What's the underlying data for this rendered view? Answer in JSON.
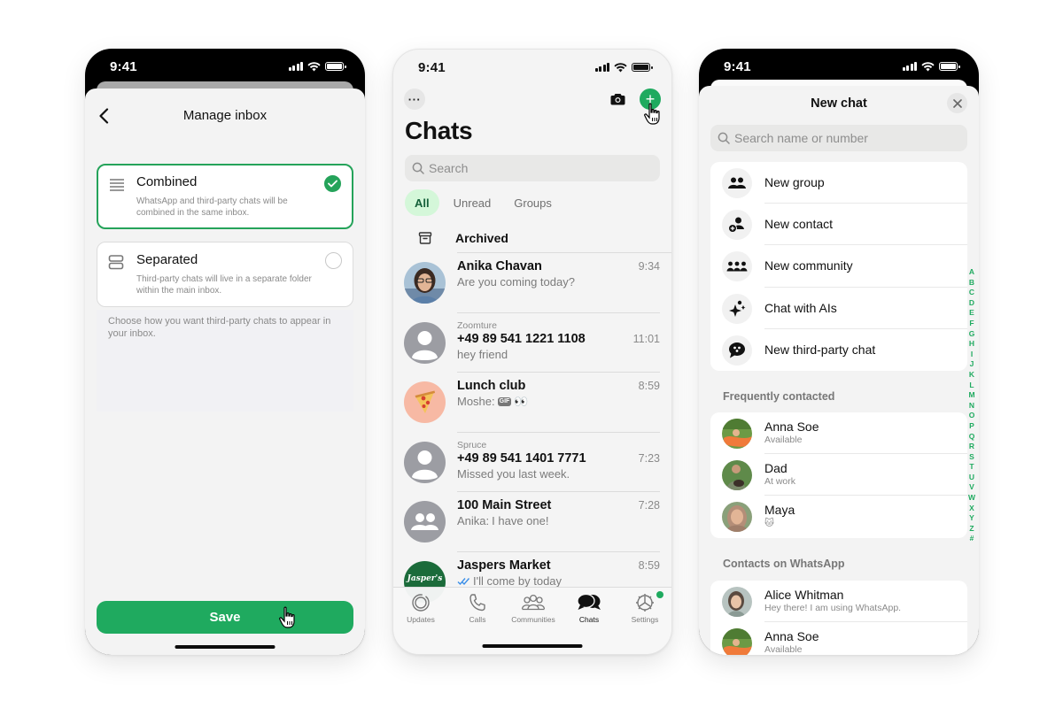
{
  "status_bar": {
    "time": "9:41"
  },
  "manage_inbox": {
    "title": "Manage inbox",
    "options": [
      {
        "title": "Combined",
        "description": "WhatsApp and third-party chats will be combined in the same inbox.",
        "selected": true,
        "icon": "lines-icon"
      },
      {
        "title": "Separated",
        "description": "Third-party chats will live in a separate folder within the main inbox.",
        "selected": false,
        "icon": "split-rows-icon"
      }
    ],
    "helper_text": "Choose how you want third-party chats to appear in your inbox.",
    "save_label": "Save"
  },
  "chats": {
    "title": "Chats",
    "search_placeholder": "Search",
    "filters": [
      {
        "label": "All",
        "active": true
      },
      {
        "label": "Unread",
        "active": false
      },
      {
        "label": "Groups",
        "active": false
      }
    ],
    "archived_label": "Archived",
    "list": [
      {
        "sub_label": "",
        "name": "Anika Chavan",
        "preview": "Are you coming today?",
        "time": "9:34",
        "avatar": "photo"
      },
      {
        "sub_label": "Zoomture",
        "name": "+49 89 541 1221 1108",
        "preview": "hey friend",
        "time": "11:01",
        "avatar": "default-person"
      },
      {
        "sub_label": "",
        "name": "Lunch club",
        "preview_sender": "Moshe:",
        "preview": "👀",
        "preview_badge": "GIF",
        "time": "8:59",
        "avatar": "pizza"
      },
      {
        "sub_label": "Spruce",
        "name": "+49 89 541 1401 7771",
        "preview": "Missed you last week.",
        "time": "7:23",
        "avatar": "default-person"
      },
      {
        "sub_label": "",
        "name": "100 Main Street",
        "preview_sender": "Anika:",
        "preview": "I have one!",
        "time": "7:28",
        "avatar": "default-group"
      },
      {
        "sub_label": "",
        "name": "Jaspers Market",
        "preview": "I'll come by today",
        "read_receipt": "double-check",
        "time": "8:59",
        "avatar": "jaspers-logo",
        "avatar_text": "Jasper's"
      }
    ],
    "tabs": [
      {
        "label": "Updates",
        "icon": "updates-icon",
        "active": false
      },
      {
        "label": "Calls",
        "icon": "phone-icon",
        "active": false
      },
      {
        "label": "Communities",
        "icon": "communities-icon",
        "active": false
      },
      {
        "label": "Chats",
        "icon": "chat-bubbles-icon",
        "active": true
      },
      {
        "label": "Settings",
        "icon": "gear-icon",
        "active": false,
        "badge": true
      }
    ]
  },
  "new_chat": {
    "title": "New chat",
    "search_placeholder": "Search name or number",
    "actions": [
      {
        "label": "New group",
        "icon": "group-icon"
      },
      {
        "label": "New contact",
        "icon": "add-contact-icon"
      },
      {
        "label": "New community",
        "icon": "community-icon"
      },
      {
        "label": "Chat with AIs",
        "icon": "sparkle-icon"
      },
      {
        "label": "New third-party chat",
        "icon": "third-party-chat-icon"
      }
    ],
    "frequent_header": "Frequently contacted",
    "frequent": [
      {
        "name": "Anna Soe",
        "status": "Available"
      },
      {
        "name": "Dad",
        "status": "At work"
      },
      {
        "name": "Maya",
        "status": "🐱"
      }
    ],
    "contacts_header": "Contacts on WhatsApp",
    "contacts": [
      {
        "name": "Alice Whitman",
        "status": "Hey there! I am using WhatsApp."
      },
      {
        "name": "Anna Soe",
        "status": "Available"
      }
    ],
    "alpha_index": [
      "A",
      "B",
      "C",
      "D",
      "E",
      "F",
      "G",
      "H",
      "I",
      "J",
      "K",
      "L",
      "M",
      "N",
      "O",
      "P",
      "Q",
      "R",
      "S",
      "T",
      "U",
      "V",
      "W",
      "X",
      "Y",
      "Z",
      "#"
    ]
  },
  "colors": {
    "accent": "#1faa5f",
    "chip_active_bg": "#d4f7d9",
    "chip_active_text": "#15603a"
  }
}
